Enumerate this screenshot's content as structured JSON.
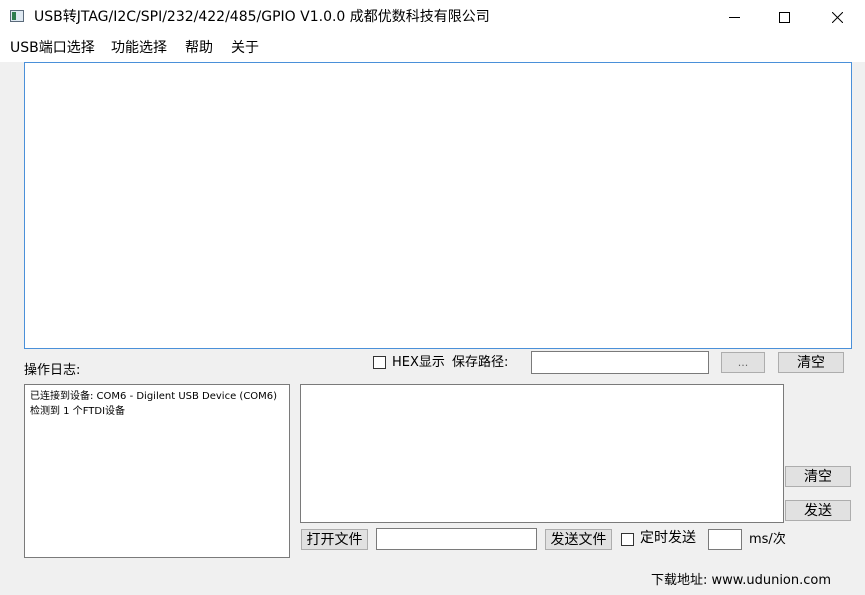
{
  "window": {
    "title": "USB转JTAG/I2C/SPI/232/422/485/GPIO  V1.0.0    成都优数科技有限公司",
    "icons": {
      "app": "app-icon",
      "minimize": "minimize-icon",
      "maximize": "maximize-icon",
      "close": "close-icon"
    }
  },
  "menu": {
    "items": [
      {
        "label": "USB端口选择"
      },
      {
        "label": "功能选择"
      },
      {
        "label": "帮助"
      },
      {
        "label": "关于"
      }
    ]
  },
  "receive_area": {
    "text": ""
  },
  "log": {
    "label": "操作日志:",
    "lines": [
      "已连接到设备: COM6 - Digilent USB Device (COM6)",
      "检测到 1 个FTDI设备"
    ]
  },
  "receive_controls": {
    "hex_display_label": "HEX显示",
    "hex_display_checked": false,
    "save_path_label": "保存路径:",
    "save_path_value": "",
    "browse_label": "...",
    "clear_label": "清空"
  },
  "send_controls": {
    "send_text": "",
    "clear_label": "清空",
    "send_label": "发送",
    "open_file_label": "打开文件",
    "file_path_value": "",
    "send_file_label": "发送文件",
    "timed_send_label": "定时发送",
    "timed_send_checked": false,
    "interval_value": "",
    "interval_unit": "ms/次"
  },
  "footer": {
    "download_text": "下载地址: www.udunion.com"
  }
}
